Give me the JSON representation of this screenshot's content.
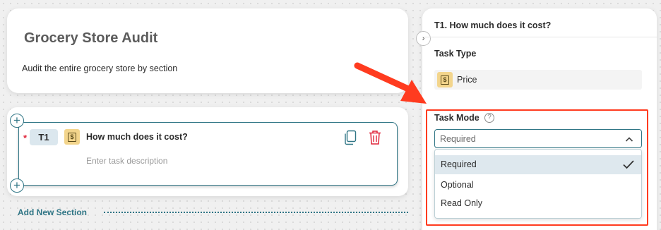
{
  "form": {
    "title": "Grocery Store Audit",
    "description": "Audit the entire grocery store by section"
  },
  "task": {
    "badge": "T1",
    "required_marker": "*",
    "title": "How much does it cost?",
    "description_placeholder": "Enter task description",
    "type_icon": "price-icon"
  },
  "add_section": "Add New Section",
  "panel": {
    "title": "T1. How much does it cost?",
    "task_type_label": "Task Type",
    "task_type_value": "Price",
    "task_mode_label": "Task Mode",
    "task_mode_value": "Required",
    "task_mode_options": [
      "Required",
      "Optional",
      "Read Only"
    ],
    "selected_option": "Required"
  },
  "icons": {
    "plus": "+",
    "chevron_right": "›",
    "help": "?",
    "dollar": "$"
  },
  "colors": {
    "accent": "#2f7585",
    "highlight": "#ff3b1f",
    "required": "#e0253a",
    "price_icon_bg": "#f3d58c",
    "selected_bg": "#dee8ee"
  }
}
